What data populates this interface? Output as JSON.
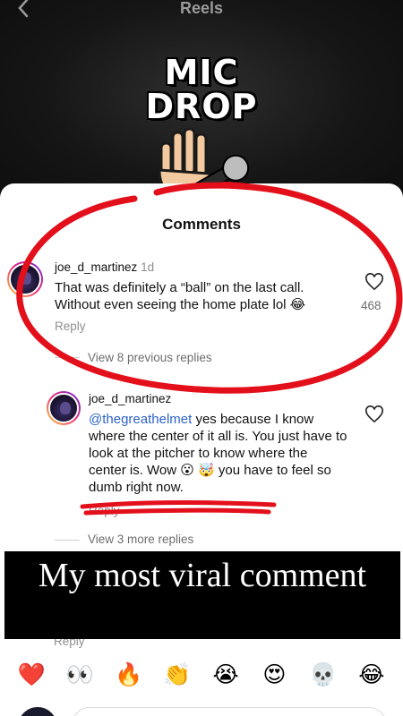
{
  "header": {
    "title": "Reels"
  },
  "reel": {
    "caption_line1": "MIC",
    "caption_line2": "DROP"
  },
  "comments_sheet": {
    "title": "Comments",
    "comment": {
      "username": "joe_d_martinez",
      "time": "1d",
      "text": "That was definitely a “ball” on the last call. Without even seeing the home plate lol 😂",
      "reply_label": "Reply",
      "likes": "468"
    },
    "view_previous_replies": "View 8 previous replies",
    "reply": {
      "username": "joe_d_martinez",
      "mention": "@thegreathelmet",
      "text": " yes because I know where the center of it all is. You just have to look at the pitcher to know where the center is. Wow 😮 🤯 you have to feel so dumb right now.",
      "reply_label": "Reply"
    },
    "view_more_replies": "View 3 more replies",
    "reply_under_banner": "Reply"
  },
  "banner": {
    "text": "My most viral comment",
    "emoji": "😂"
  },
  "emoji_bar": [
    "❤️",
    "👀",
    "🔥",
    "👏",
    "😭",
    "😍",
    "💀",
    "😂"
  ],
  "colors": {
    "annotation_red": "#e3101b",
    "mention_blue": "#2d63c8"
  }
}
